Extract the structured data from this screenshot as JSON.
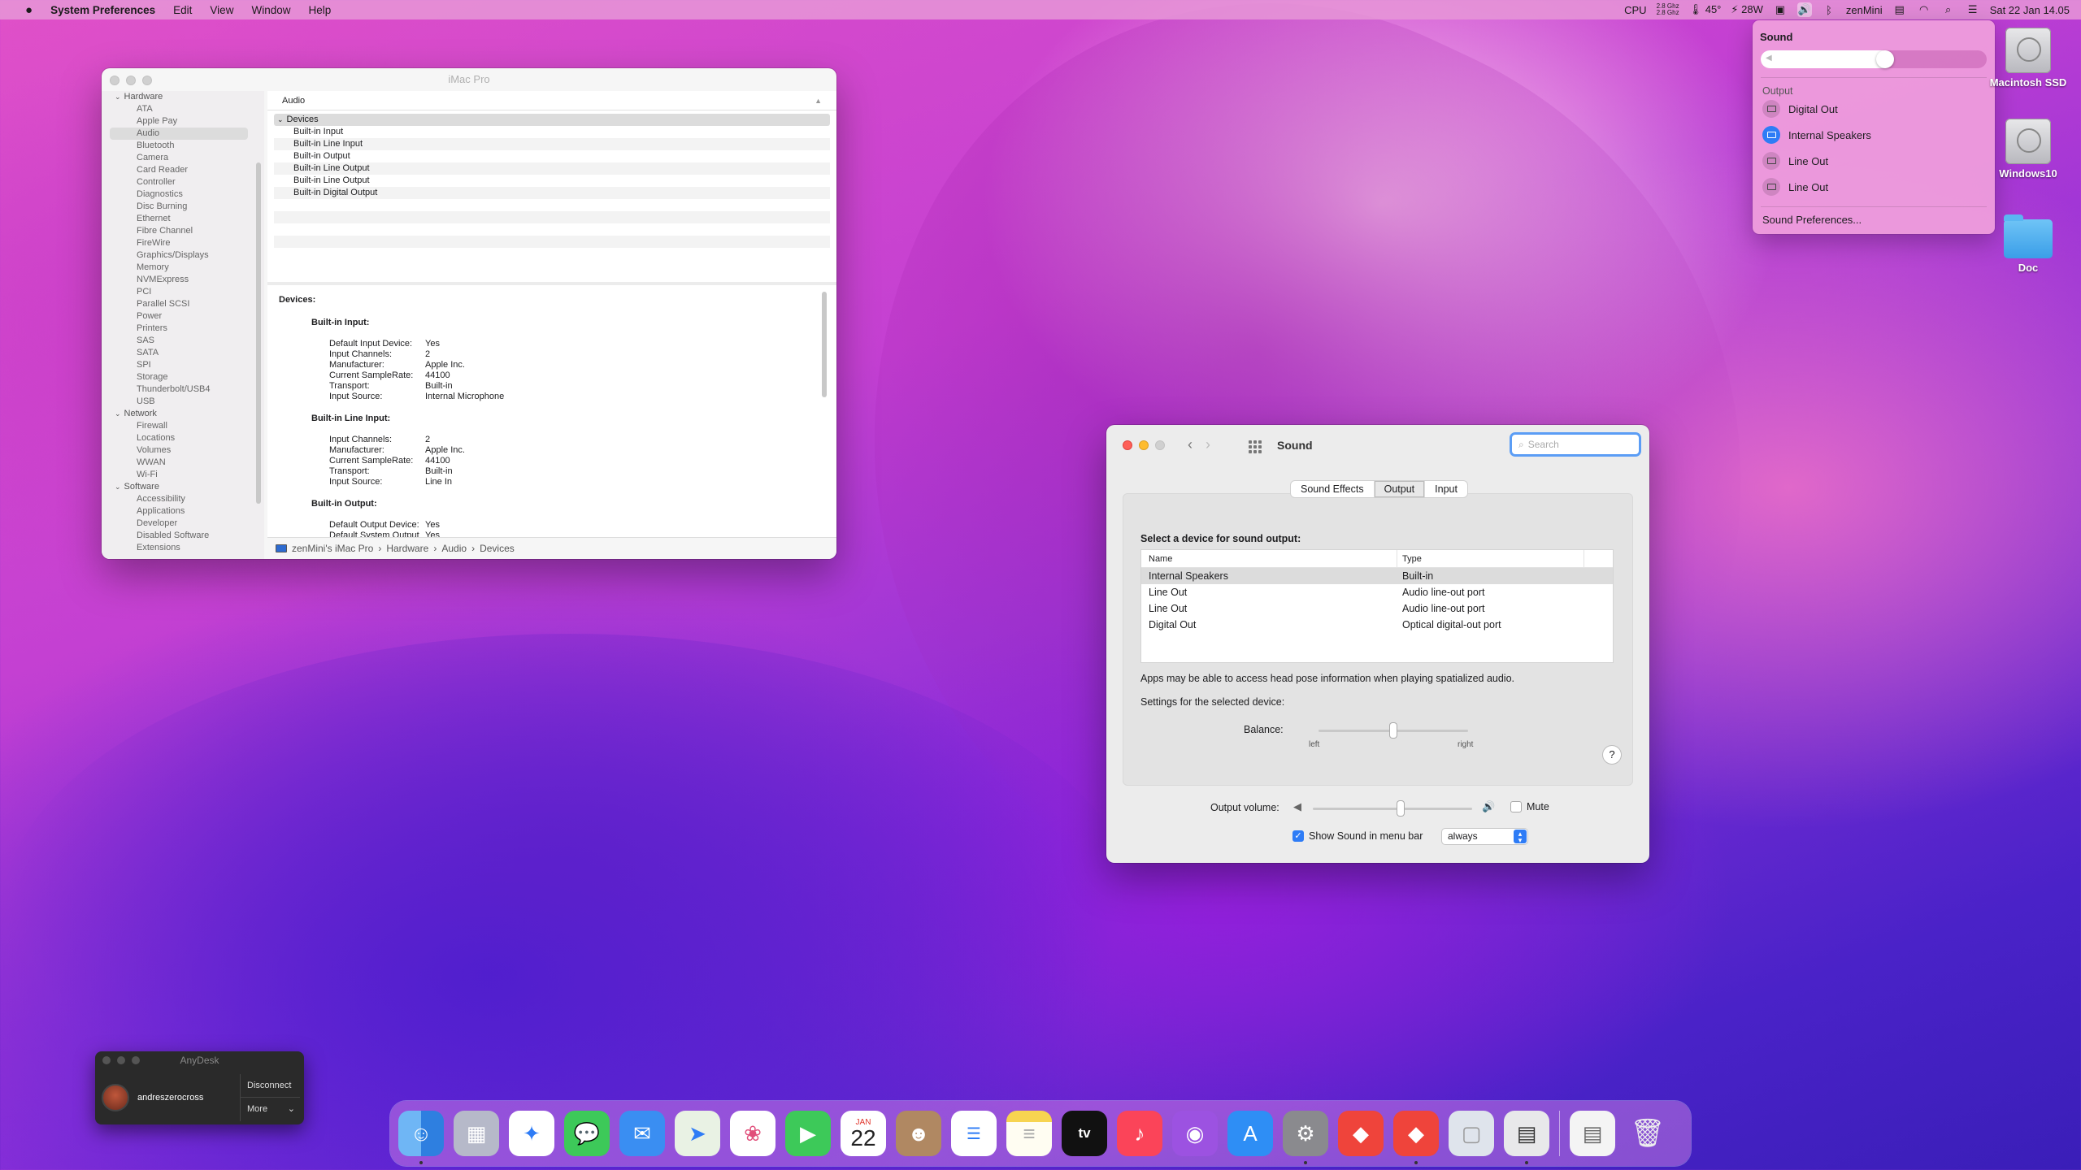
{
  "menubar": {
    "app_name": "System Preferences",
    "menus": [
      "Edit",
      "View",
      "Window",
      "Help"
    ],
    "cpu_label": "CPU",
    "cpu_freq_top": "2.8 Ghz",
    "cpu_freq_bottom": "2.8 Ghz",
    "temp": "45°",
    "power": "28W",
    "user": "zenMini",
    "datetime": "Sat 22 Jan  14.05"
  },
  "sysinfo": {
    "title": "iMac Pro",
    "sidebar": {
      "hardware_group": "Hardware",
      "hardware_items": [
        "ATA",
        "Apple Pay",
        "Audio",
        "Bluetooth",
        "Camera",
        "Card Reader",
        "Controller",
        "Diagnostics",
        "Disc Burning",
        "Ethernet",
        "Fibre Channel",
        "FireWire",
        "Graphics/Displays",
        "Memory",
        "NVMExpress",
        "PCI",
        "Parallel SCSI",
        "Power",
        "Printers",
        "SAS",
        "SATA",
        "SPI",
        "Storage",
        "Thunderbolt/USB4",
        "USB"
      ],
      "network_group": "Network",
      "network_items": [
        "Firewall",
        "Locations",
        "Volumes",
        "WWAN",
        "Wi-Fi"
      ],
      "software_group": "Software",
      "software_items": [
        "Accessibility",
        "Applications",
        "Developer",
        "Disabled Software",
        "Extensions"
      ]
    },
    "column_header": "Audio",
    "tree_group": "Devices",
    "tree_items": [
      "Built-in Input",
      "Built-in Line Input",
      "Built-in Output",
      "Built-in Line Output",
      "Built-in Line Output",
      "Built-in Digital Output"
    ],
    "detail": {
      "heading": "Devices:",
      "sections": [
        {
          "title": "Built-in Input:",
          "rows": [
            [
              "Default Input Device:",
              "Yes"
            ],
            [
              "Input Channels:",
              "2"
            ],
            [
              "Manufacturer:",
              "Apple Inc."
            ],
            [
              "Current SampleRate:",
              "44100"
            ],
            [
              "Transport:",
              "Built-in"
            ],
            [
              "Input Source:",
              "Internal Microphone"
            ]
          ]
        },
        {
          "title": "Built-in Line Input:",
          "rows": [
            [
              "Input Channels:",
              "2"
            ],
            [
              "Manufacturer:",
              "Apple Inc."
            ],
            [
              "Current SampleRate:",
              "44100"
            ],
            [
              "Transport:",
              "Built-in"
            ],
            [
              "Input Source:",
              "Line In"
            ]
          ]
        },
        {
          "title": "Built-in Output:",
          "rows": [
            [
              "Default Output Device:",
              "Yes"
            ],
            [
              "Default System Output Device:",
              "Yes"
            ]
          ]
        }
      ]
    },
    "path": [
      "zenMini's iMac Pro",
      "Hardware",
      "Audio",
      "Devices"
    ]
  },
  "sound_window": {
    "title": "Sound",
    "search_placeholder": "Search",
    "tabs": [
      "Sound Effects",
      "Output",
      "Input"
    ],
    "active_tab": "Output",
    "select_label": "Select a device for sound output:",
    "col_name": "Name",
    "col_type": "Type",
    "devices": [
      {
        "name": "Internal Speakers",
        "type": "Built-in",
        "selected": true
      },
      {
        "name": "Line Out",
        "type": "Audio line-out port",
        "selected": false
      },
      {
        "name": "Line Out",
        "type": "Audio line-out port",
        "selected": false
      },
      {
        "name": "Digital Out",
        "type": "Optical digital-out port",
        "selected": false
      }
    ],
    "spatial_note": "Apps may be able to access head pose information when playing spatialized audio.",
    "settings_label": "Settings for the selected device:",
    "balance_label": "Balance:",
    "balance_left": "left",
    "balance_right": "right",
    "balance_value": 0.5,
    "help": "?",
    "output_volume_label": "Output volume:",
    "output_volume": 0.55,
    "mute_label": "Mute",
    "mute": false,
    "show_in_menubar_label": "Show Sound in menu bar",
    "show_in_menubar": true,
    "menubar_mode": "always"
  },
  "sound_menu": {
    "title": "Sound",
    "volume": 0.55,
    "output_label": "Output",
    "devices": [
      {
        "name": "Digital Out",
        "active": false
      },
      {
        "name": "Internal Speakers",
        "active": true
      },
      {
        "name": "Line Out",
        "active": false
      },
      {
        "name": "Line Out",
        "active": false
      }
    ],
    "preferences": "Sound Preferences..."
  },
  "desktop_icons": [
    "Macintosh SSD",
    "Windows10",
    "Doc"
  ],
  "anydesk": {
    "title": "AnyDesk",
    "user": "andreszerocross",
    "disconnect": "Disconnect",
    "more": "More"
  },
  "dock": {
    "calendar_month": "JAN",
    "calendar_day": "22",
    "tv_label": "tv"
  }
}
